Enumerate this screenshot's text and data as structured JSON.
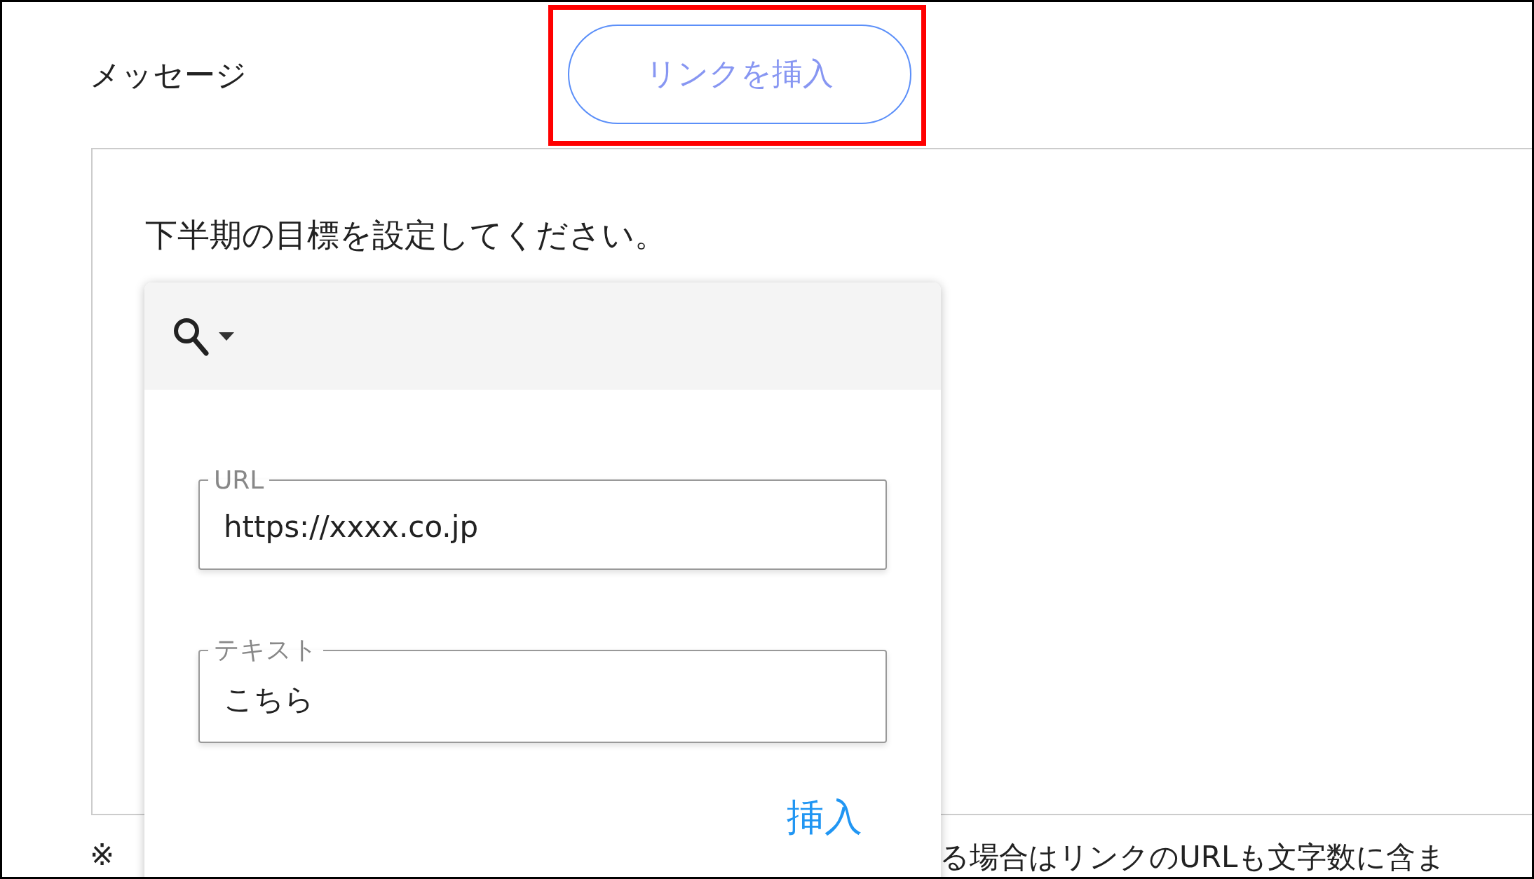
{
  "heading": "メッセージ",
  "insert_link_button": {
    "label": "リンクを挿入",
    "highlighted": true
  },
  "message": {
    "text": "下半期の目標を設定してください。"
  },
  "link_popup": {
    "fields": [
      {
        "label": "URL",
        "value": "https://xxxx.co.jp"
      },
      {
        "label": "テキスト",
        "value": "こちら"
      }
    ],
    "action": "挿入"
  },
  "note": [
    "※",
    "る場合はリンクのURLも文字数に含ま"
  ]
}
